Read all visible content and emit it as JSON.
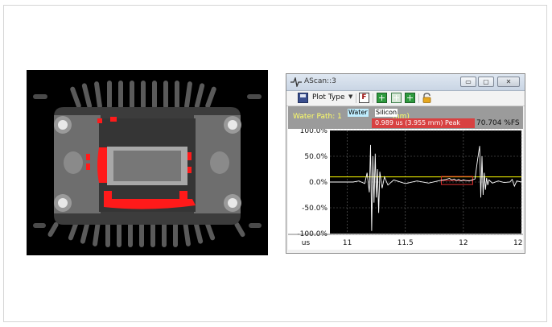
{
  "window": {
    "title": "AScan::3",
    "minimize_label": "▭",
    "maximize_label": "▢",
    "close_label": "✕"
  },
  "toolbar": {
    "plot_type_label": "Plot Type",
    "f_button_label": "F"
  },
  "info": {
    "water_path": "Water Path: 1",
    "water_path_tail": "mm)",
    "gate_water": "Water",
    "gate_silicon": "Silicon",
    "peak_readout": "0.989 us (3.955 mm)  Peak",
    "fs_readout": "70.704 %FS"
  },
  "colors": {
    "plot_bg": "#000000",
    "signal": "#ffffff",
    "water_gate": "#ffff00",
    "silicon_gate": "#e03030",
    "info_bg": "#9b9b9b"
  },
  "icons": {
    "save": "save-icon",
    "dropdown": "chevron-down-icon",
    "grid_a": "grid-icon",
    "grid_b": "grid-layout-icon",
    "grid_c": "grid-fill-icon",
    "lock": "lock-icon",
    "app": "waveform-icon"
  },
  "chart_data": {
    "type": "line",
    "title": "",
    "xlabel": "us",
    "ylabel": "",
    "xlim": [
      10.85,
      12.5
    ],
    "ylim": [
      -100,
      100
    ],
    "x_ticks": [
      11,
      11.5,
      12,
      12.5
    ],
    "x_tick_labels": [
      "11",
      "11.5",
      "12",
      "12.5"
    ],
    "y_ticks": [
      100,
      50,
      0,
      -50,
      -100
    ],
    "y_tick_labels": [
      "100.0%",
      "50.0%",
      "0.0%",
      "-50.0%",
      "-100.0%"
    ],
    "grid": true,
    "series": [
      {
        "x": [
          10.85,
          11.05,
          11.1,
          11.15,
          11.17,
          11.19,
          11.2,
          11.21,
          11.22,
          11.23,
          11.24,
          11.25,
          11.26,
          11.27,
          11.28,
          11.3,
          11.32,
          11.35,
          11.4,
          11.5,
          11.6,
          11.7,
          11.8,
          11.85,
          11.88,
          11.9,
          11.92,
          11.94,
          11.96,
          11.98,
          12.0,
          12.02,
          12.05,
          12.1,
          12.12,
          12.14,
          12.15,
          12.16,
          12.17,
          12.18,
          12.19,
          12.2,
          12.21,
          12.22,
          12.25,
          12.3,
          12.35,
          12.4,
          12.42,
          12.44,
          12.46,
          12.5
        ],
        "y": [
          0,
          0,
          2,
          -3,
          18,
          -20,
          72,
          -95,
          50,
          -40,
          55,
          -30,
          25,
          -60,
          20,
          -12,
          10,
          -6,
          4,
          -3,
          2,
          -2,
          3,
          5,
          7,
          4,
          6,
          3,
          5,
          2,
          4,
          3,
          2,
          6,
          40,
          70,
          -30,
          50,
          -25,
          18,
          -15,
          8,
          -6,
          4,
          -2,
          2,
          -1,
          0,
          5,
          -8,
          2,
          0
        ]
      }
    ],
    "gates": [
      {
        "label": "Water",
        "level": 10,
        "x_start": 10.85,
        "x_end": 12.5
      },
      {
        "label": "Silicon",
        "level": 3,
        "x_start": 11.81,
        "x_end": 12.08
      }
    ]
  }
}
